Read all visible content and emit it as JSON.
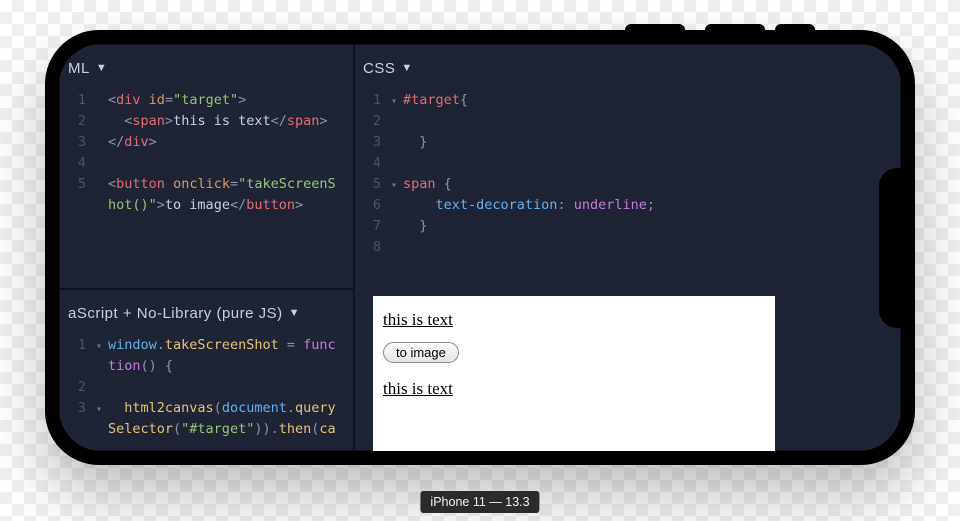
{
  "device_label": "iPhone 11 — 13.3",
  "panes": {
    "html": {
      "title": "ML",
      "lines": [
        {
          "n": "1",
          "fold": "",
          "parts": [
            {
              "c": "punct",
              "t": "<"
            },
            {
              "c": "tag",
              "t": "div"
            },
            {
              "c": "plain",
              "t": " "
            },
            {
              "c": "attr",
              "t": "id"
            },
            {
              "c": "punct",
              "t": "="
            },
            {
              "c": "str",
              "t": "\"target\""
            },
            {
              "c": "punct",
              "t": ">"
            }
          ]
        },
        {
          "n": "2",
          "fold": "",
          "parts": [
            {
              "c": "plain",
              "t": "  "
            },
            {
              "c": "punct",
              "t": "<"
            },
            {
              "c": "tag",
              "t": "span"
            },
            {
              "c": "punct",
              "t": ">"
            },
            {
              "c": "plain",
              "t": "this is text"
            },
            {
              "c": "punct",
              "t": "</"
            },
            {
              "c": "tag",
              "t": "span"
            },
            {
              "c": "punct",
              "t": ">"
            }
          ]
        },
        {
          "n": "3",
          "fold": "",
          "parts": [
            {
              "c": "punct",
              "t": "</"
            },
            {
              "c": "tag",
              "t": "div"
            },
            {
              "c": "punct",
              "t": ">"
            }
          ]
        },
        {
          "n": "4",
          "fold": "",
          "parts": [
            {
              "c": "plain",
              "t": ""
            }
          ]
        },
        {
          "n": "5",
          "fold": "",
          "parts": [
            {
              "c": "punct",
              "t": "<"
            },
            {
              "c": "tag",
              "t": "button"
            },
            {
              "c": "plain",
              "t": " "
            },
            {
              "c": "attr",
              "t": "onclick"
            },
            {
              "c": "punct",
              "t": "="
            },
            {
              "c": "str",
              "t": "\"takeScreenS"
            }
          ]
        },
        {
          "n": "",
          "fold": "",
          "parts": [
            {
              "c": "str",
              "t": "hot()\""
            },
            {
              "c": "punct",
              "t": ">"
            },
            {
              "c": "plain",
              "t": "to image"
            },
            {
              "c": "punct",
              "t": "</"
            },
            {
              "c": "tag",
              "t": "button"
            },
            {
              "c": "punct",
              "t": ">"
            }
          ]
        }
      ]
    },
    "css": {
      "title": "CSS",
      "lines": [
        {
          "n": "1",
          "fold": "▾",
          "parts": [
            {
              "c": "sel",
              "t": "#target"
            },
            {
              "c": "punct",
              "t": "{"
            }
          ]
        },
        {
          "n": "2",
          "fold": "",
          "parts": [
            {
              "c": "plain",
              "t": ""
            }
          ]
        },
        {
          "n": "3",
          "fold": "",
          "parts": [
            {
              "c": "plain",
              "t": "  "
            },
            {
              "c": "punct",
              "t": "}"
            }
          ]
        },
        {
          "n": "4",
          "fold": "",
          "parts": [
            {
              "c": "plain",
              "t": ""
            }
          ]
        },
        {
          "n": "5",
          "fold": "▾",
          "parts": [
            {
              "c": "sel",
              "t": "span"
            },
            {
              "c": "plain",
              "t": " "
            },
            {
              "c": "punct",
              "t": "{"
            }
          ]
        },
        {
          "n": "6",
          "fold": "",
          "parts": [
            {
              "c": "plain",
              "t": "    "
            },
            {
              "c": "prop",
              "t": "text-decoration"
            },
            {
              "c": "punct",
              "t": ": "
            },
            {
              "c": "val",
              "t": "underline"
            },
            {
              "c": "punct",
              "t": ";"
            }
          ]
        },
        {
          "n": "7",
          "fold": "",
          "parts": [
            {
              "c": "plain",
              "t": "  "
            },
            {
              "c": "punct",
              "t": "}"
            }
          ]
        },
        {
          "n": "8",
          "fold": "",
          "parts": [
            {
              "c": "plain",
              "t": ""
            }
          ]
        }
      ]
    },
    "js": {
      "title": "aScript + No-Library (pure JS)",
      "lines": [
        {
          "n": "1",
          "fold": "▾",
          "parts": [
            {
              "c": "obj",
              "t": "window"
            },
            {
              "c": "punct",
              "t": "."
            },
            {
              "c": "fn",
              "t": "takeScreenShot"
            },
            {
              "c": "plain",
              "t": " "
            },
            {
              "c": "punct",
              "t": "="
            },
            {
              "c": "plain",
              "t": " "
            },
            {
              "c": "kw",
              "t": "func"
            }
          ]
        },
        {
          "n": "",
          "fold": "",
          "parts": [
            {
              "c": "kw",
              "t": "tion"
            },
            {
              "c": "paren",
              "t": "() {"
            }
          ]
        },
        {
          "n": "2",
          "fold": "",
          "parts": [
            {
              "c": "plain",
              "t": ""
            }
          ]
        },
        {
          "n": "3",
          "fold": "▾",
          "parts": [
            {
              "c": "plain",
              "t": "  "
            },
            {
              "c": "fn",
              "t": "html2canvas"
            },
            {
              "c": "paren",
              "t": "("
            },
            {
              "c": "obj",
              "t": "document"
            },
            {
              "c": "punct",
              "t": "."
            },
            {
              "c": "fn",
              "t": "query"
            }
          ]
        },
        {
          "n": "",
          "fold": "",
          "parts": [
            {
              "c": "fn",
              "t": "Selector"
            },
            {
              "c": "paren",
              "t": "("
            },
            {
              "c": "str",
              "t": "\"#target\""
            },
            {
              "c": "paren",
              "t": "))"
            },
            {
              "c": "punct",
              "t": "."
            },
            {
              "c": "fn",
              "t": "then"
            },
            {
              "c": "paren",
              "t": "("
            },
            {
              "c": "fn",
              "t": "ca"
            }
          ]
        }
      ]
    }
  },
  "preview": {
    "text1": "this is text",
    "button": "to image",
    "text2": "this is text"
  }
}
